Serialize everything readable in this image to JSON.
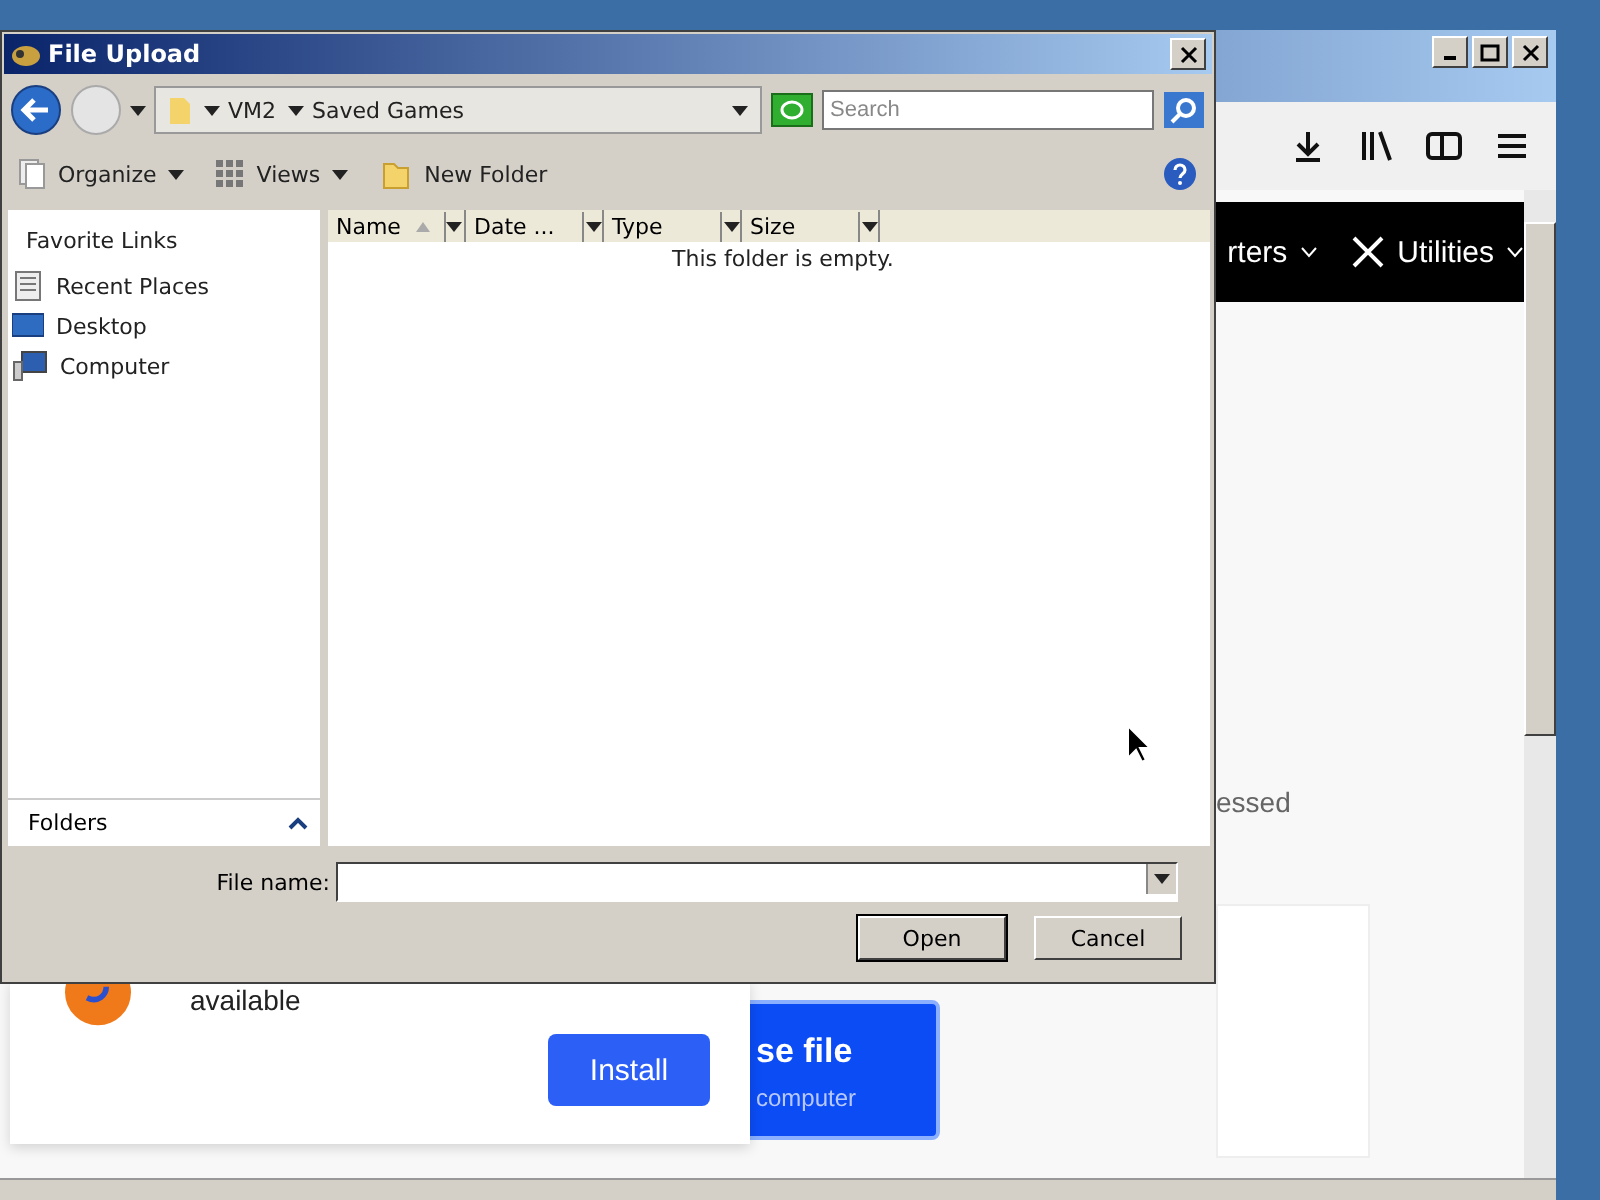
{
  "browser": {
    "nav_items": [
      "rters",
      "Utilities"
    ],
    "partial_text": "essed",
    "notification": {
      "text": "available",
      "button": "Install"
    },
    "upload_button": {
      "title": "se file",
      "subtitle": "computer"
    }
  },
  "dialog": {
    "title": "File Upload",
    "breadcrumbs": [
      "VM2",
      "Saved Games"
    ],
    "search": {
      "placeholder": "Search"
    },
    "toolbar": [
      {
        "label": "Organize",
        "kind": "organize"
      },
      {
        "label": "Views",
        "kind": "views"
      },
      {
        "label": "New Folder",
        "kind": "folder"
      }
    ],
    "favorites": {
      "heading": "Favorite Links",
      "items": [
        {
          "label": "Recent Places",
          "kind": "recent"
        },
        {
          "label": "Desktop",
          "kind": "desktop"
        },
        {
          "label": "Computer",
          "kind": "computer"
        }
      ]
    },
    "folders_label": "Folders",
    "columns": [
      {
        "label": "Name",
        "sorted": true
      },
      {
        "label": "Date ...",
        "sorted": false
      },
      {
        "label": "Type",
        "sorted": false
      },
      {
        "label": "Size",
        "sorted": false
      }
    ],
    "empty_message": "This folder is empty.",
    "file_name": {
      "label": "File name:"
    },
    "buttons": [
      "Open",
      "Cancel"
    ]
  }
}
